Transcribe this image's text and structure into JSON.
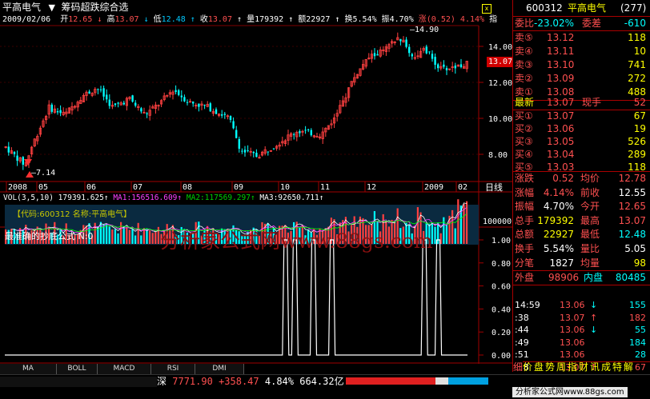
{
  "header": {
    "stock_name": "平高电气",
    "formula_name": "筹码超跌综合选",
    "arrow": "↓",
    "date": "2009/02/06",
    "open_label": "开",
    "open": "12.65",
    "high_label": "高",
    "high": "13.07",
    "low_label": "低",
    "low": "12.48",
    "close_label": "收",
    "close": "13.07",
    "volume_label": "量",
    "volume": "179392",
    "amount_label": "额",
    "amount": "22927",
    "turnover_label": "换",
    "turnover": "5.54%",
    "amp_label": "振",
    "amp": "4.70%",
    "chg_label": "涨",
    "chg": "(0.52)",
    "chg_pct": "4.14%",
    "more": "指"
  },
  "price_axis": {
    "labels": [
      "14.00",
      "12.00",
      "10.00",
      "8.00"
    ],
    "current": "13.07",
    "high_mark": "14.90",
    "low_mark": "7.14"
  },
  "time_axis": {
    "labels": [
      "2008",
      "05",
      "06",
      "07",
      "08",
      "09",
      "10",
      "11",
      "12",
      "2009",
      "02"
    ],
    "period": "日线"
  },
  "volume_panel": {
    "title": "VOL(3,5,10)",
    "vol": "179391.625",
    "ma1": "MA1:156516.609",
    "ma2": "MA2:117569.297",
    "ma3": "MA3:92650.711",
    "overlay": "【代码:600312 名称:平高电气】",
    "axis_label": "100000"
  },
  "indicator_panel": {
    "title": "最准确的抄底公式 N:0",
    "axis": [
      "1.00",
      "0.80",
      "0.60",
      "0.40",
      "0.20",
      "0.00"
    ],
    "watermark": "分析家公式网www.88gs.com",
    "signals": [
      0.6,
      0.62,
      0.66,
      0.7,
      0.9,
      0.93
    ]
  },
  "tabs": [
    "MA",
    "BOLL",
    "MACD",
    "RSI",
    "DMI"
  ],
  "right_panel": {
    "code": "600312",
    "name": "平高电气",
    "count": "(277)",
    "weibi_label": "委比",
    "weibi": "-23.02%",
    "weicha_label": "委差",
    "weicha": "-610",
    "asks": [
      {
        "label": "卖⑤",
        "price": "13.12",
        "vol": "118"
      },
      {
        "label": "卖④",
        "price": "13.11",
        "vol": "10"
      },
      {
        "label": "卖③",
        "price": "13.10",
        "vol": "741"
      },
      {
        "label": "卖②",
        "price": "13.09",
        "vol": "272"
      },
      {
        "label": "卖①",
        "price": "13.08",
        "vol": "488"
      }
    ],
    "last_label": "最新",
    "last": "13.07",
    "hand_label": "现手",
    "hand": "52",
    "bids": [
      {
        "label": "买①",
        "price": "13.07",
        "vol": "67"
      },
      {
        "label": "买②",
        "price": "13.06",
        "vol": "19"
      },
      {
        "label": "买③",
        "price": "13.05",
        "vol": "526"
      },
      {
        "label": "买④",
        "price": "13.04",
        "vol": "289"
      },
      {
        "label": "买⑤",
        "price": "13.03",
        "vol": "118"
      }
    ],
    "stats": [
      {
        "l1": "涨跌",
        "v1": "0.52",
        "l2": "均价",
        "v2": "12.78"
      },
      {
        "l1": "涨幅",
        "v1": "4.14%",
        "l2": "前收",
        "v2": "12.55"
      },
      {
        "l1": "振幅",
        "v1": "4.70%",
        "l2": "今开",
        "v2": "12.65"
      },
      {
        "l1": "总手",
        "v1": "179392",
        "l2": "最高",
        "v2": "13.07"
      },
      {
        "l1": "总额",
        "v1": "22927",
        "l2": "最低",
        "v2": "12.48"
      },
      {
        "l1": "换手",
        "v1": "5.54%",
        "l2": "量比",
        "v2": "5.05"
      },
      {
        "l1": "分笔",
        "v1": "1827",
        "l2": "均量",
        "v2": "98"
      }
    ],
    "outer_label": "外盘",
    "outer": "98906",
    "inner_label": "内盘",
    "inner": "80485",
    "ticks": [
      {
        "time": "14:59",
        "price": "13.06",
        "dir": "↓",
        "vol": "155"
      },
      {
        "time": ":38",
        "price": "13.07",
        "dir": "↑",
        "vol": "182"
      },
      {
        "time": ":44",
        "price": "13.06",
        "dir": "↓",
        "vol": "55"
      },
      {
        "time": ":49",
        "price": "13.06",
        "dir": "",
        "vol": "184"
      },
      {
        "time": ":51",
        "price": "13.06",
        "dir": "",
        "vol": "28"
      },
      {
        "time": ":58",
        "price": "13.07",
        "dir": "↑",
        "vol": "67"
      }
    ],
    "bottom_tabs": [
      "细",
      "价",
      "盘",
      "势",
      "周",
      "指",
      "财",
      "讯",
      "成",
      "特",
      "解"
    ]
  },
  "status": {
    "market": "深",
    "index": "7771.90",
    "change": "+358.47",
    "pct": "4.84%",
    "amount": "664.32亿",
    "site": "分析家公式网www.88gs.com"
  },
  "colors": {
    "up": "#ff5050",
    "down": "#00ffff",
    "grid": "#800000",
    "yellow": "#ffff00"
  }
}
